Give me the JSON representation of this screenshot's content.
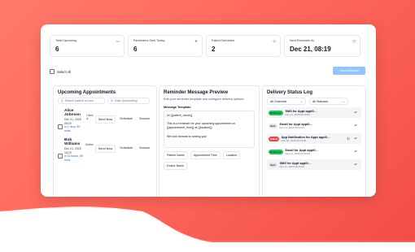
{
  "stats": [
    {
      "label": "Total Upcoming",
      "value": "6",
      "icon": "calendar-icon"
    },
    {
      "label": "Reminders Sent Today",
      "value": "6",
      "icon": "send-icon"
    },
    {
      "label": "Failed Deliveries",
      "value": "2",
      "icon": "alert-icon"
    },
    {
      "label": "Next Reminder At",
      "value": "Dec 21, 08:19",
      "icon": "clock-icon"
    }
  ],
  "select_all": "Select All",
  "send_selected": "Send Selected",
  "appointments": {
    "title": "Upcoming Appointments",
    "search_placeholder": "Search patient or loca",
    "sort_label": "Date (Ascending)",
    "items": [
      {
        "name": "Alice Johnson",
        "date": "Dec 21, 2025 08:19",
        "relative": "in 1 hour, 59 mins",
        "method": "Clinic A",
        "send": "Send Now",
        "schedule": "Schedule",
        "snooze": "Snooze"
      },
      {
        "name": "Bob Williams",
        "date": "Dec 21, 2025 18:19",
        "relative": "in 11 hours, 59 mins",
        "method": "Online",
        "send": "Send Now",
        "schedule": "Schedule",
        "snooze": "Snooze"
      }
    ]
  },
  "preview": {
    "title": "Reminder Message Preview",
    "subtitle": "Edit your reminder template and configure delivery options.",
    "template_label": "Message Template",
    "template_lines": [
      "Hi {{patient_name}},",
      "",
      "This is a reminder for your upcoming appointment on {{appointment_time}} at {{location}}.",
      "",
      "We look forward to seeing you!"
    ],
    "chips": [
      "Patient Name",
      "Appointment Time",
      "Location",
      "Doctor Name"
    ]
  },
  "log": {
    "title": "Delivery Status Log",
    "channel_filter": "All Channels",
    "status_filter": "All Statuses",
    "entries": [
      {
        "status": "Delivered",
        "status_kind": "green",
        "title": "SMS for Appt appt0...",
        "date": "Dec 21, 2025 03:19:00",
        "retry": false
      },
      {
        "status": "Sent",
        "status_kind": "gray",
        "title": "Email for Appt appt0...",
        "date": "Dec 21, 2025 03:16:09",
        "retry": false
      },
      {
        "status": "Failed",
        "status_kind": "red",
        "title": "App Notification for Appt appt0...",
        "date": "Dec 20, 2025 03:19:00",
        "retry": true
      },
      {
        "status": "Delivered",
        "status_kind": "green",
        "title": "Email for Appt appt0...",
        "date": "Dec 21, 2025 03:19:00",
        "retry": false
      },
      {
        "status": "Sent",
        "status_kind": "gray",
        "title": "SMS for Appt appt0...",
        "date": "Dec 21, 2025 02:19:00",
        "retry": false
      }
    ]
  },
  "colors": {
    "accent": "#93c5fd",
    "background": "#ff6a5e",
    "delivered": "#22c55e",
    "failed": "#ef4444"
  }
}
